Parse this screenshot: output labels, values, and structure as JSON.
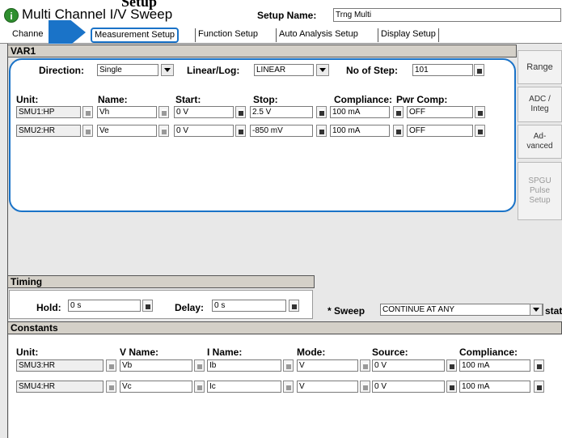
{
  "header": {
    "title_prefix": "Multi Channel I/V Sweep",
    "setup_name_label": "Setup Name:",
    "setup_name_value": "Trng Multi",
    "overlay_text": "Setup"
  },
  "tabs": [
    {
      "label": "Channe"
    },
    {
      "label": "Measurement Setup"
    },
    {
      "label": "Function Setup"
    },
    {
      "label": "Auto Analysis Setup"
    },
    {
      "label": "Display Setup"
    }
  ],
  "var1": {
    "title": "VAR1",
    "direction_label": "Direction:",
    "direction_value": "Single",
    "linlog_label": "Linear/Log:",
    "linlog_value": "LINEAR",
    "steps_label": "No of Step:",
    "steps_value": "101",
    "headers": {
      "unit": "Unit:",
      "name": "Name:",
      "start": "Start:",
      "stop": "Stop:",
      "compliance": "Compliance:",
      "pwr_comp": "Pwr Comp:"
    },
    "rows": [
      {
        "unit": "SMU1:HP",
        "name": "Vh",
        "start": "0 V",
        "stop": "2.5 V",
        "compliance": "100 mA",
        "pwr_comp": "OFF"
      },
      {
        "unit": "SMU2:HR",
        "name": "Ve",
        "start": "0 V",
        "stop": "-850 mV",
        "compliance": "100 mA",
        "pwr_comp": "OFF"
      }
    ]
  },
  "side_buttons": [
    {
      "label": "Range"
    },
    {
      "label": "ADC / Integ"
    },
    {
      "label": "Ad-vanced"
    },
    {
      "label": "SPGU Pulse Setup"
    }
  ],
  "timing": {
    "title": "Timing",
    "hold_label": "Hold:",
    "hold_value": "0 s",
    "delay_label": "Delay:",
    "delay_value": "0 s",
    "sweep_label": "* Sweep",
    "sweep_value": "CONTINUE AT ANY",
    "status_label": "status"
  },
  "constants": {
    "title": "Constants",
    "headers": {
      "unit": "Unit:",
      "vname": "V Name:",
      "iname": "I Name:",
      "mode": "Mode:",
      "source": "Source:",
      "compliance": "Compliance:"
    },
    "rows": [
      {
        "unit": "SMU3:HR",
        "vname": "Vb",
        "iname": "Ib",
        "mode": "V",
        "source": "0 V",
        "compliance": "100 mA"
      },
      {
        "unit": "SMU4:HR",
        "vname": "Vc",
        "iname": "Ic",
        "mode": "V",
        "source": "0 V",
        "compliance": "100 mA"
      }
    ]
  },
  "colors": {
    "highlight": "#1a73c8",
    "panel": "#d4d0c8",
    "window_bg": "#e8e8e8"
  }
}
